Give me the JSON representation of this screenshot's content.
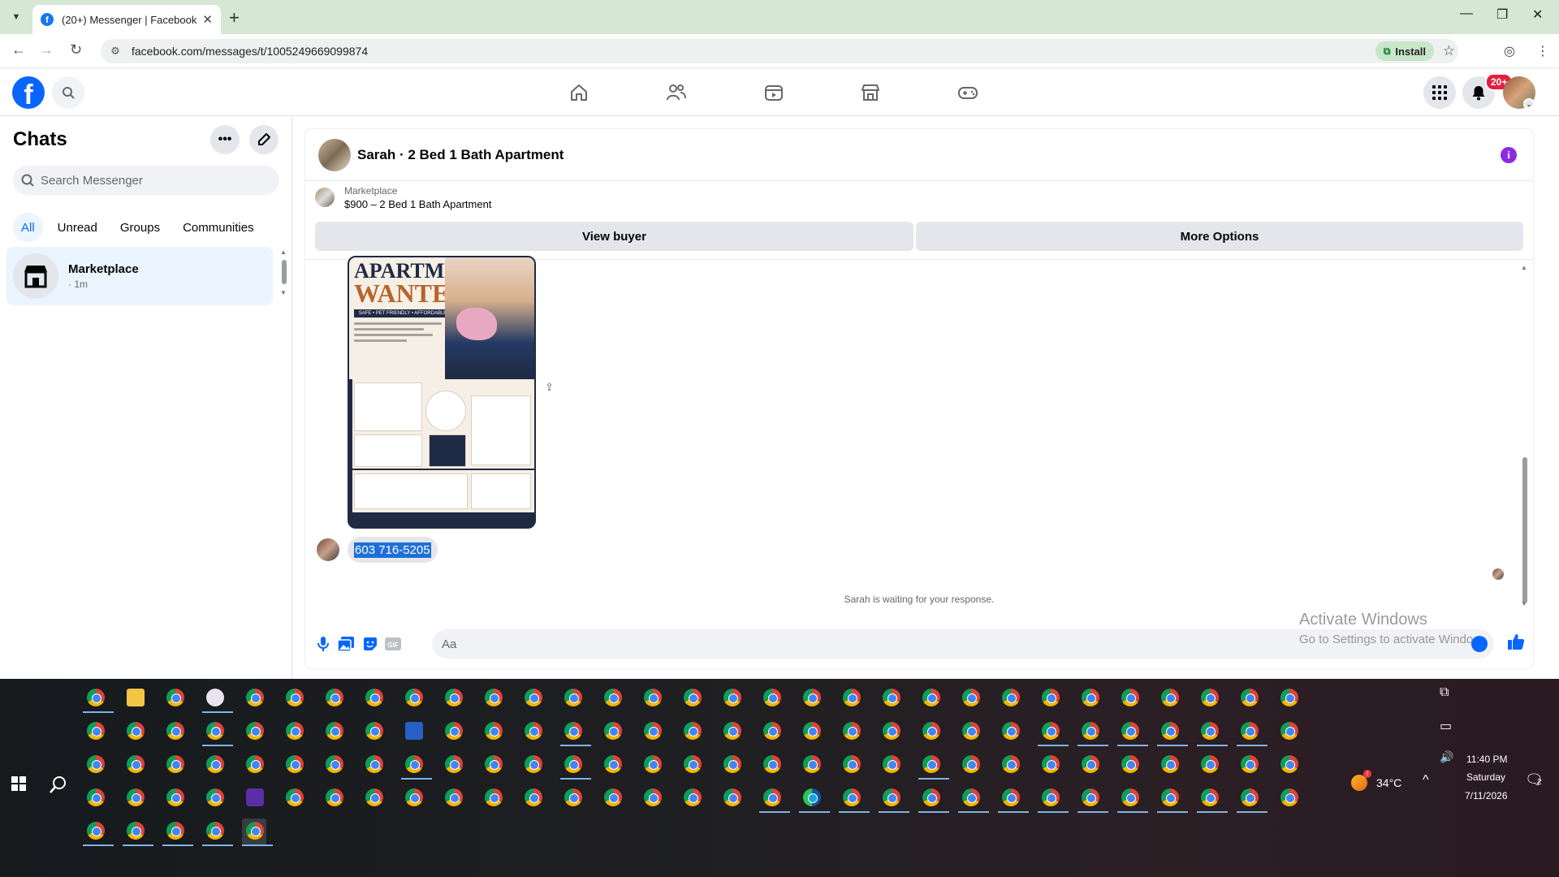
{
  "browser": {
    "tab_title": "(20+) Messenger | Facebook",
    "url": "facebook.com/messages/t/1005249669099874",
    "install_label": "Install"
  },
  "facebook": {
    "notification_badge": "20+"
  },
  "sidebar": {
    "title": "Chats",
    "search_placeholder": "Search Messenger",
    "filters": [
      "All",
      "Unread",
      "Groups",
      "Communities"
    ],
    "conversations": [
      {
        "name": "Marketplace",
        "time": "· 1m"
      }
    ]
  },
  "conversation": {
    "title": "Sarah · 2 Bed 1 Bath Apartment",
    "marketplace_label": "Marketplace",
    "listing": "$900 – 2 Bed 1 Bath Apartment",
    "view_buyer_label": "View buyer",
    "more_options_label": "More Options",
    "flyer": {
      "headline1": "APARTMENT",
      "headline2": "WANTED!",
      "tagline": "SAFE • PET FRIENDLY • AFFORDABLE"
    },
    "message_text": "603 716-5205",
    "waiting_text": "Sarah is waiting for your response.",
    "composer_placeholder": "Aa"
  },
  "watermark": {
    "line1": "Activate Windows",
    "line2": "Go to Settings to activate Windo"
  },
  "taskbar": {
    "temperature": "34°C",
    "time": "11:40 PM",
    "day": "Saturday",
    "date": "7/11/2026",
    "notification_count": "2"
  },
  "colors": {
    "facebook_blue": "#0866ff",
    "selection_blue": "#1f6fd8",
    "info_purple": "#8a2be2",
    "badge_red": "#e41e3f"
  }
}
